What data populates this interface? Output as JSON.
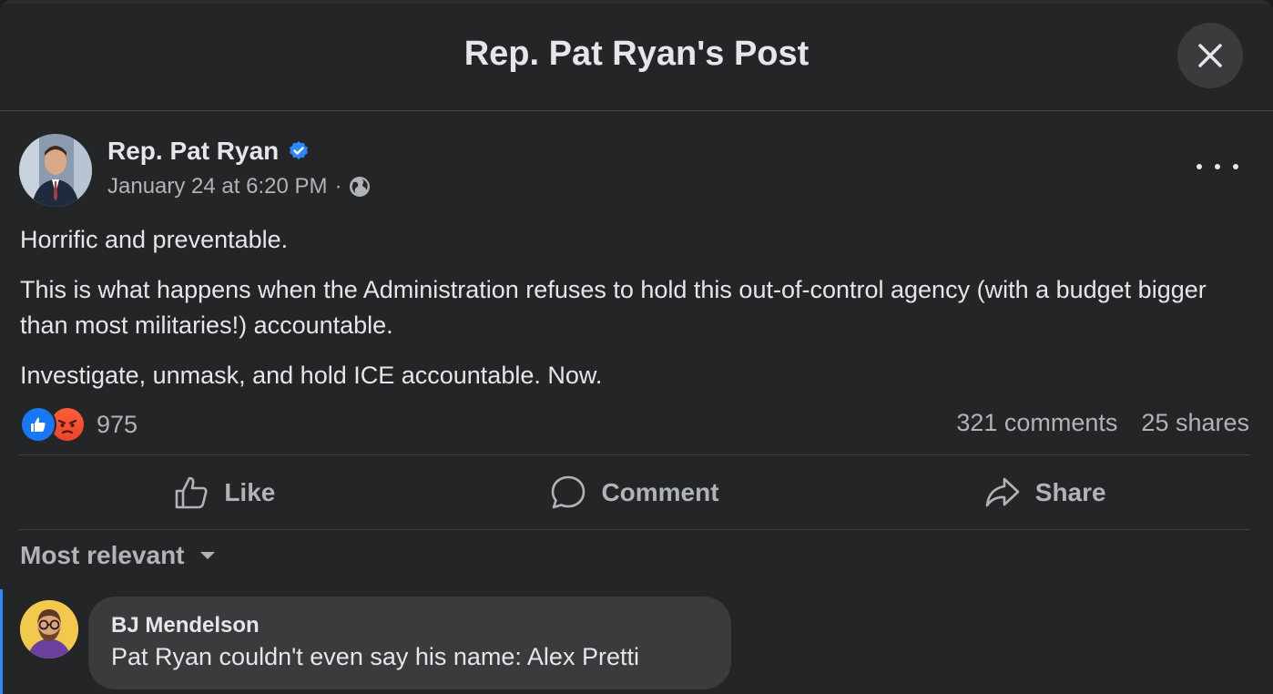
{
  "header": {
    "title": "Rep. Pat Ryan's Post"
  },
  "post": {
    "author": "Rep. Pat Ryan",
    "timestamp": "January 24 at 6:20 PM",
    "separator": "·",
    "paragraphs": [
      "Horrific and preventable.",
      "This is what happens when the Administration refuses to hold this out-of-control agency (with a budget bigger than most militaries!) accountable.",
      "Investigate, unmask, and hold ICE accountable. Now."
    ],
    "reaction_count": "975",
    "comments_count": "321 comments",
    "shares_count": "25 shares"
  },
  "actions": {
    "like": "Like",
    "comment": "Comment",
    "share": "Share"
  },
  "comments": {
    "sort_label": "Most relevant",
    "items": [
      {
        "author": "BJ Mendelson",
        "text": "Pat Ryan couldn't even say his name: Alex Pretti"
      }
    ]
  },
  "colors": {
    "accent": "#1877f2",
    "angry": "#f0512f",
    "background": "#242526",
    "bubble": "#3a3b3c"
  },
  "icons": [
    "close-icon",
    "verified-badge-icon",
    "globe-icon",
    "more-options-icon",
    "like-reaction-icon",
    "angry-reaction-icon",
    "thumbs-up-icon",
    "comment-icon",
    "share-icon",
    "chevron-down-icon"
  ]
}
